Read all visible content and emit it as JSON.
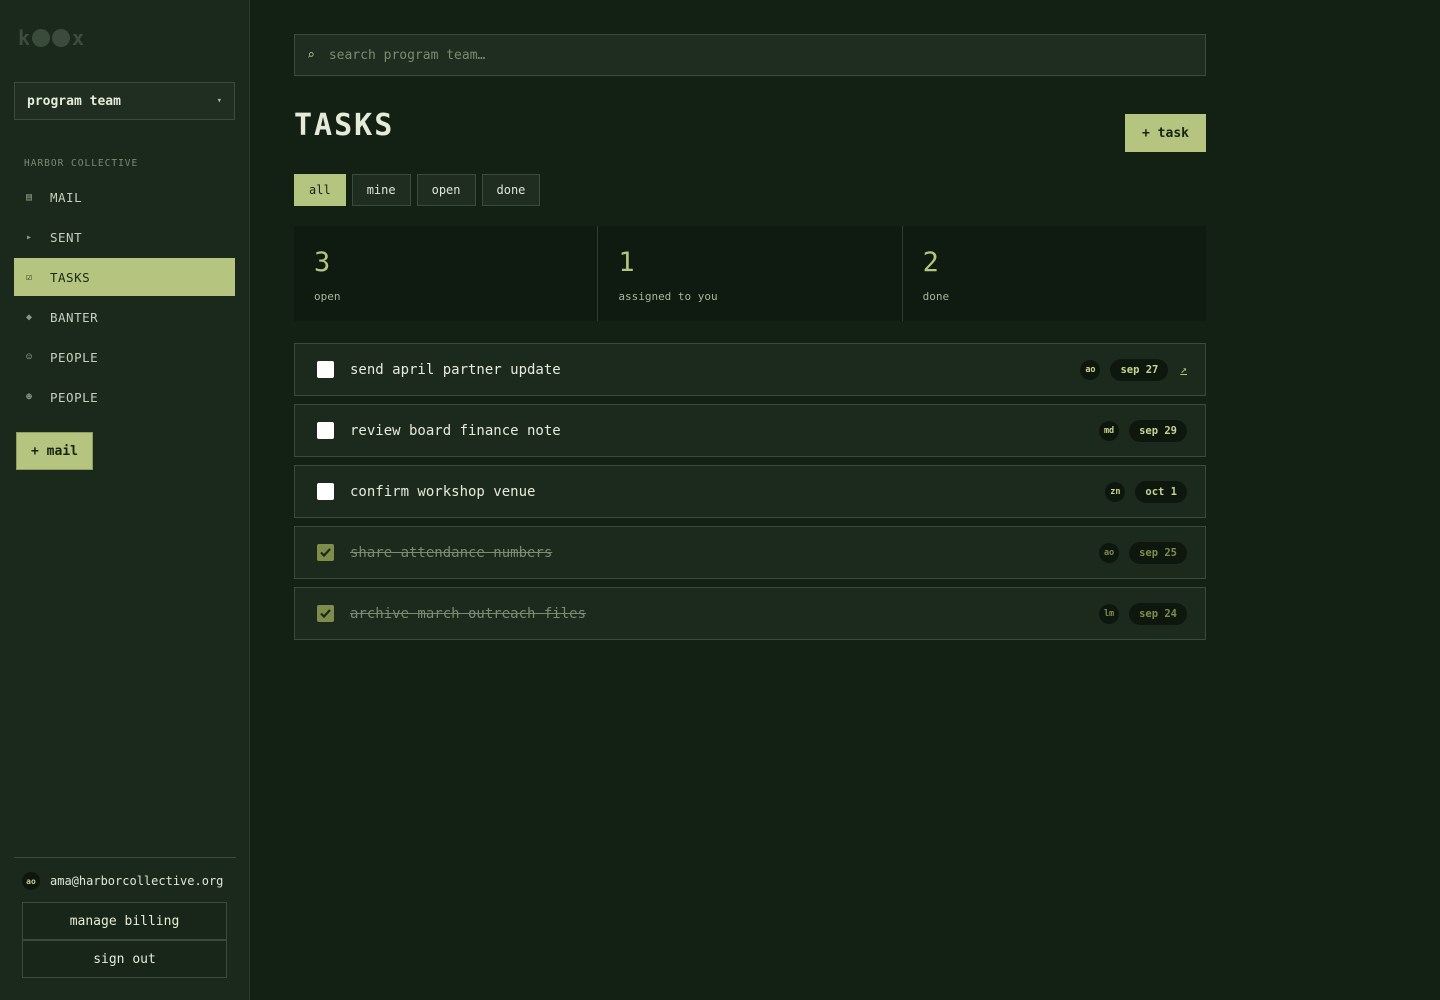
{
  "brand": {
    "logo_text_left": "k",
    "logo_text_right": "x"
  },
  "sidebar": {
    "team_select": {
      "value": "program team",
      "chevron": "▾"
    },
    "org_label": "HARBOR COLLECTIVE",
    "items": [
      {
        "label": "MAIL",
        "icon": "▤",
        "icon_name": "mail-icon",
        "active": false
      },
      {
        "label": "SENT",
        "icon": "▸",
        "icon_name": "sent-icon",
        "active": false
      },
      {
        "label": "TASKS",
        "icon": "☑",
        "icon_name": "tasks-icon",
        "active": true
      },
      {
        "label": "BANTER",
        "icon": "◆",
        "icon_name": "banter-icon",
        "active": false
      },
      {
        "label": "PEOPLE",
        "icon": "☺",
        "icon_name": "people-icon",
        "active": false
      },
      {
        "label": "PEOPLE",
        "icon": "☻",
        "icon_name": "people-alt-icon",
        "active": false
      }
    ],
    "compose_label": "+ mail",
    "user": {
      "initials": "ao",
      "email": "ama@harborcollective.org"
    },
    "manage_billing": "manage billing",
    "sign_out": "sign out"
  },
  "search": {
    "icon": "⌕",
    "placeholder": "search program team…",
    "value": ""
  },
  "page": {
    "title": "TASKS",
    "add_task_label": "+ task"
  },
  "filters": [
    {
      "label": "all",
      "active": true
    },
    {
      "label": "mine",
      "active": false
    },
    {
      "label": "open",
      "active": false
    },
    {
      "label": "done",
      "active": false
    }
  ],
  "stats": [
    {
      "value": "3",
      "label": "open"
    },
    {
      "value": "1",
      "label": "assigned to you"
    },
    {
      "value": "2",
      "label": "done"
    }
  ],
  "tasks": [
    {
      "title": "send april partner update",
      "assignee": "ao",
      "due": "sep 27",
      "done": false,
      "link": "↗"
    },
    {
      "title": "review board finance note",
      "assignee": "md",
      "due": "sep 29",
      "done": false,
      "link": ""
    },
    {
      "title": "confirm workshop venue",
      "assignee": "zn",
      "due": "oct 1",
      "done": false,
      "link": ""
    },
    {
      "title": "share attendance numbers",
      "assignee": "ao",
      "due": "sep 25",
      "done": true,
      "link": ""
    },
    {
      "title": "archive march outreach files",
      "assignee": "lm",
      "due": "sep 24",
      "done": true,
      "link": ""
    }
  ],
  "colors": {
    "accent": "#b5c47f",
    "background": "#132014",
    "sidebar": "#1a291b"
  }
}
